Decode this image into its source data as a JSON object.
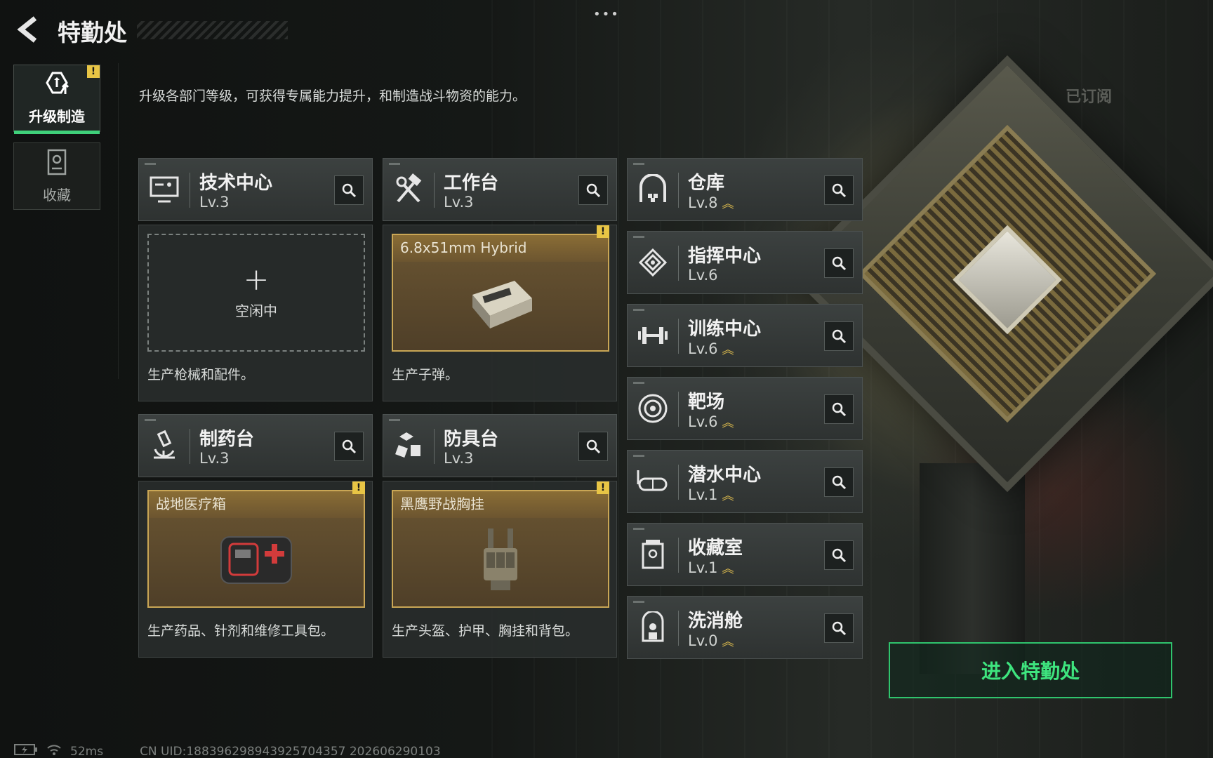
{
  "header": {
    "title": "特勤处",
    "back_icon": "chevron-left-icon",
    "more_label": "•••"
  },
  "sidebar": {
    "tabs": [
      {
        "label": "升级制造",
        "icon": "upgrade-icon",
        "active": true,
        "badge": "!"
      },
      {
        "label": "收藏",
        "icon": "collection-icon",
        "active": false
      }
    ]
  },
  "main": {
    "description": "升级各部门等级，可获得专属能力提升，和制造战斗物资的能力。",
    "subscribed_label": "已订阅"
  },
  "workshops": [
    {
      "name": "技术中心",
      "level": "Lv.3",
      "icon": "monitor-icon",
      "slot_type": "idle",
      "slot_label": "空闲中",
      "desc": "生产枪械和配件。"
    },
    {
      "name": "工作台",
      "level": "Lv.3",
      "icon": "hammer-wrench-icon",
      "slot_type": "item",
      "item_name": "6.8x51mm Hybrid",
      "item_icon": "ammo-box-icon",
      "badge": "!",
      "desc": "生产子弹。"
    },
    {
      "name": "制药台",
      "level": "Lv.3",
      "icon": "microscope-icon",
      "slot_type": "item",
      "item_name": "战地医疗箱",
      "item_icon": "medkit-icon",
      "badge": "!",
      "desc": "生产药品、针剂和维修工具包。"
    },
    {
      "name": "防具台",
      "level": "Lv.3",
      "icon": "armor-parts-icon",
      "slot_type": "item",
      "item_name": "黑鹰野战胸挂",
      "item_icon": "chest-rig-icon",
      "badge": "!",
      "desc": "生产头盔、护甲、胸挂和背包。"
    }
  ],
  "departments": [
    {
      "name": "仓库",
      "level": "Lv.8",
      "upgradable": true,
      "icon": "warehouse-icon"
    },
    {
      "name": "指挥中心",
      "level": "Lv.6",
      "upgradable": false,
      "icon": "chip-icon"
    },
    {
      "name": "训练中心",
      "level": "Lv.6",
      "upgradable": true,
      "icon": "dumbbell-icon"
    },
    {
      "name": "靶场",
      "level": "Lv.6",
      "upgradable": true,
      "icon": "target-icon"
    },
    {
      "name": "潜水中心",
      "level": "Lv.1",
      "upgradable": true,
      "icon": "diving-mask-icon"
    },
    {
      "name": "收藏室",
      "level": "Lv.1",
      "upgradable": true,
      "icon": "trophy-cabinet-icon"
    },
    {
      "name": "洗消舱",
      "level": "Lv.0",
      "upgradable": true,
      "icon": "decontamination-icon"
    }
  ],
  "enter_button": {
    "label": "进入特勤处"
  },
  "footer": {
    "ping": "52ms",
    "uid": "CN UID:188396298943925704357 202606290103"
  },
  "colors": {
    "accent_green": "#3ee47e",
    "warning_yellow": "#e8c545",
    "item_gold": "#c9a655"
  }
}
